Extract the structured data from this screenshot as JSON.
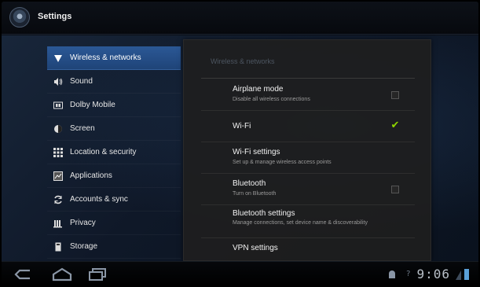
{
  "app": {
    "title": "Settings",
    "icon": "settings-gear-icon"
  },
  "headers": [
    {
      "label": "Wireless & networks",
      "icon": "wifi-icon",
      "selected": true
    },
    {
      "label": "Sound",
      "icon": "speaker-icon",
      "selected": false
    },
    {
      "label": "Dolby Mobile",
      "icon": "dolby-icon",
      "selected": false
    },
    {
      "label": "Screen",
      "icon": "screen-icon",
      "selected": false
    },
    {
      "label": "Location & security",
      "icon": "location-icon",
      "selected": false
    },
    {
      "label": "Applications",
      "icon": "applications-icon",
      "selected": false
    },
    {
      "label": "Accounts & sync",
      "icon": "sync-icon",
      "selected": false
    },
    {
      "label": "Privacy",
      "icon": "privacy-icon",
      "selected": false
    },
    {
      "label": "Storage",
      "icon": "storage-icon",
      "selected": false
    }
  ],
  "panel": {
    "header": "Wireless & networks",
    "prefs": [
      {
        "title": "Airplane mode",
        "summary": "Disable all wireless connections",
        "checked": false
      },
      {
        "title": "Wi-Fi",
        "summary": "",
        "checked": true
      },
      {
        "title": "Wi-Fi settings",
        "summary": "Set up & manage wireless access points"
      },
      {
        "title": "Bluetooth",
        "summary": "Turn on Bluetooth",
        "checked": false
      },
      {
        "title": "Bluetooth settings",
        "summary": "Manage connections, set device name & discoverability"
      },
      {
        "title": "VPN settings",
        "summary": ""
      }
    ]
  },
  "status": {
    "clock": "9:06"
  },
  "colors": {
    "accent": "#2b5896",
    "check": "#8fd400",
    "panel": "#1e1e1e"
  }
}
